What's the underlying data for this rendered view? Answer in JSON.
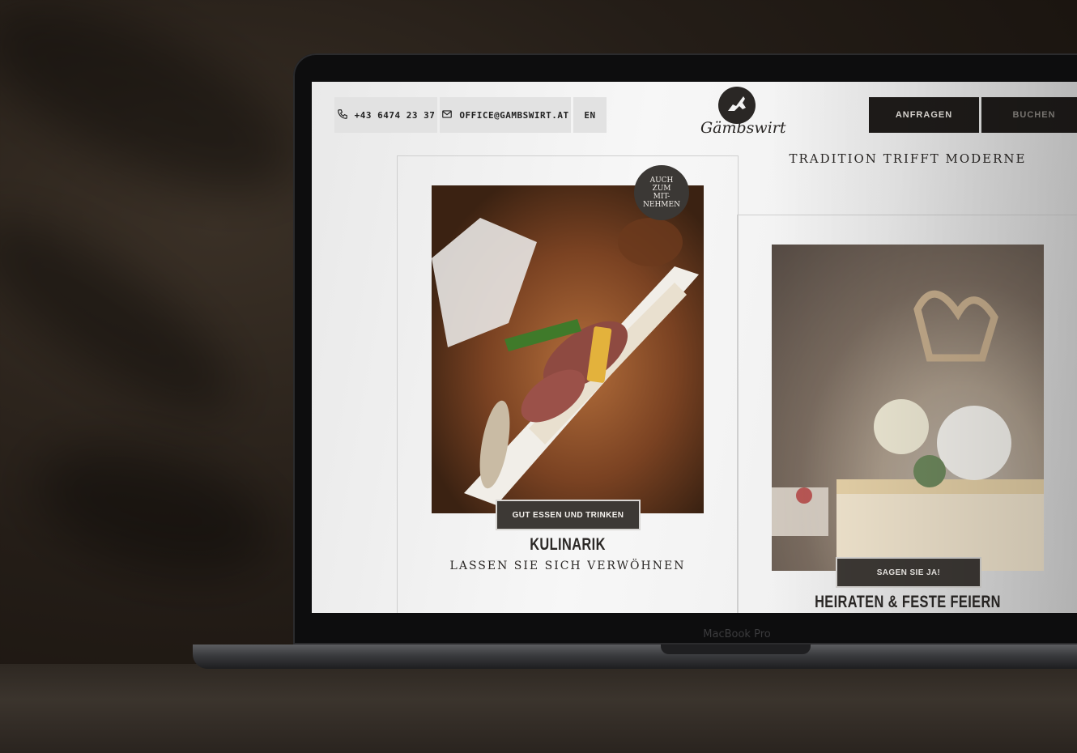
{
  "device": {
    "brand_label": "MacBook Pro"
  },
  "header": {
    "phone": {
      "icon": "phone-icon",
      "label": "+43 6474 23 37"
    },
    "email": {
      "icon": "mail-icon",
      "label": "OFFICE@GAMBSWIRT.AT"
    },
    "language": "EN",
    "logo_text": "Gämbswirt",
    "cta_primary": "ANFRAGEN",
    "cta_secondary": "BUCHEN"
  },
  "tagline": "TRADITION TRIFFT MODERNE",
  "cards": [
    {
      "badge": [
        "AUCH",
        "ZUM",
        "MIT-",
        "NEHMEN"
      ],
      "chip": "GUT ESSEN UND TRINKEN",
      "title": "KULINARIK",
      "subtitle": "LASSEN SIE SICH VERWÖHNEN"
    },
    {
      "chip": "SAGEN SIE JA!",
      "title": "HEIRATEN & FESTE FEIERN"
    }
  ],
  "colors": {
    "dark": "#1f1c1a",
    "chip": "#3d3935",
    "page": "#f3f3f3"
  }
}
